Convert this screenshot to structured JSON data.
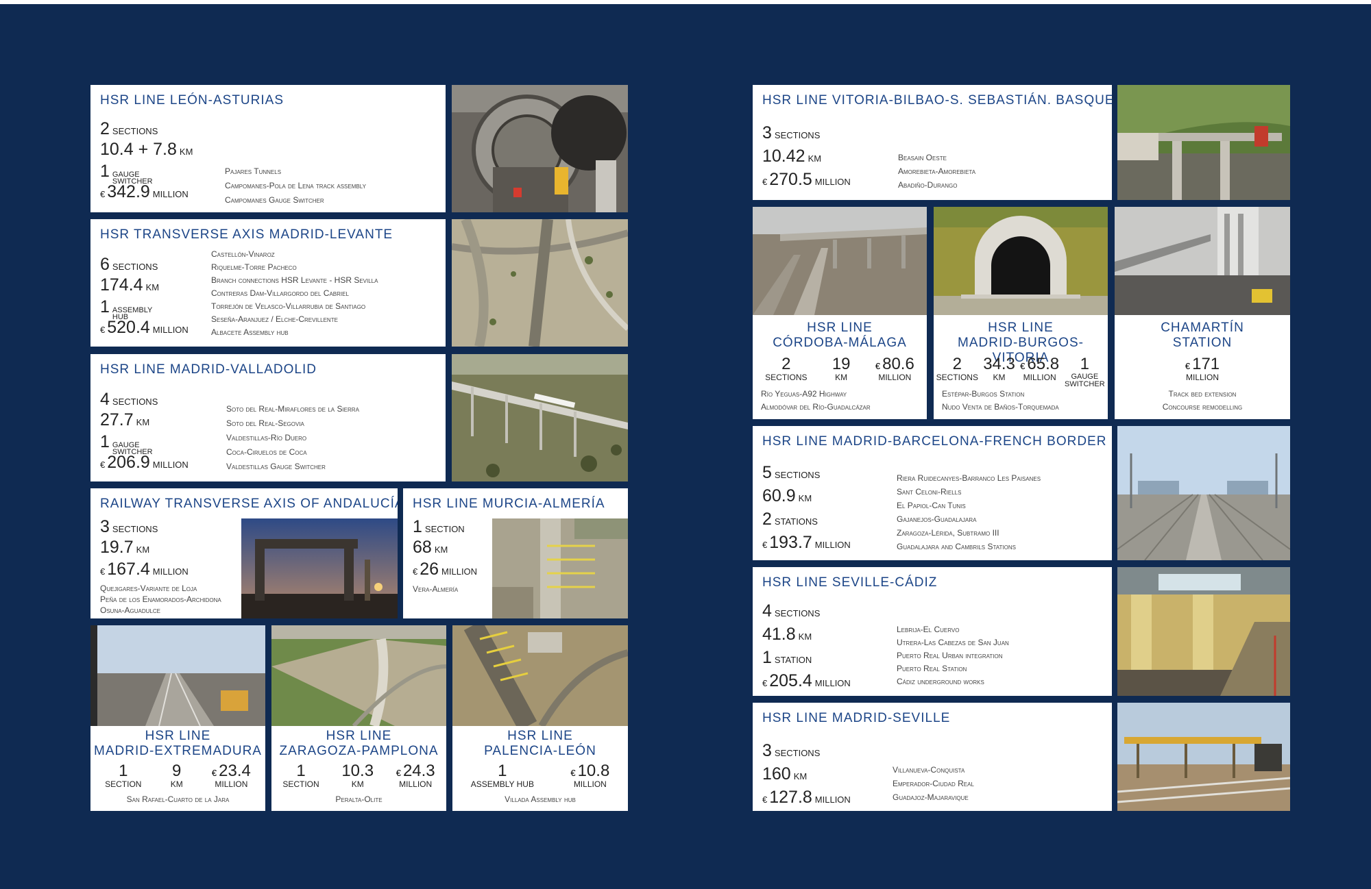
{
  "colors": {
    "page_bg": "#0f2a52",
    "title": "#1c4587",
    "card": "#ffffff"
  },
  "cards": {
    "leon": {
      "title": "HSR LINE LEÓN-ASTURIAS",
      "s1n": "2",
      "s1u": "SECTIONS",
      "s2n": "10.4 + 7.8",
      "s2u": "KM",
      "s3n": "1",
      "s3u": "GAUGE SWITCHER",
      "eur": "€",
      "s4n": "342.9",
      "s4u": "MILLION",
      "works": [
        "Pajares Tunnels",
        "Campomanes-Pola de Lena track assembly",
        "Campomanes Gauge Switcher"
      ]
    },
    "levante": {
      "title": "HSR TRANSVERSE AXIS MADRID-LEVANTE",
      "s1n": "6",
      "s1u": "SECTIONS",
      "s2n": "174.4",
      "s2u": "KM",
      "s3n": "1",
      "s3u": "ASSEMBLY HUB",
      "eur": "€",
      "s4n": "520.4",
      "s4u": "MILLION",
      "works": [
        "Castellón-Vinaroz",
        "Riquelme-Torre Pacheco",
        "Branch connections HSR Levante - HSR Sevilla",
        "Contreras Dam-Villargordo del Cabriel",
        "Torrejón de Velasco-Villarrubia de Santiago",
        "Seseña-Aranjuez / Elche-Crevillente",
        "Albacete Assembly hub"
      ]
    },
    "valladolid": {
      "title": "HSR LINE MADRID-VALLADOLID",
      "s1n": "4",
      "s1u": "SECTIONS",
      "s2n": "27.7",
      "s2u": "KM",
      "s3n": "1",
      "s3u": "GAUGE SWITCHER",
      "eur": "€",
      "s4n": "206.9",
      "s4u": "MILLION",
      "works": [
        "Soto del Real-Miraflores de la Sierra",
        "Soto del Real-Segovia",
        "Valdestillas-Río Duero",
        "Coca-Ciruelos de Coca",
        "Valdestillas Gauge Switcher"
      ]
    },
    "andalucia": {
      "title": "RAILWAY TRANSVERSE AXIS OF ANDALUCÍA",
      "s1n": "3",
      "s1u": "SECTIONS",
      "s2n": "19.7",
      "s2u": "KM",
      "eur": "€",
      "s3n": "167.4",
      "s3u": "MILLION",
      "works": [
        "Quejigares-Variante de Loja",
        "Peña de los Enamorados-Archidona",
        "Osuna-Aguadulce"
      ]
    },
    "murcia": {
      "title": "HSR LINE MURCIA-ALMERÍA",
      "s1n": "1",
      "s1u": "SECTION",
      "s2n": "68",
      "s2u": "KM",
      "eur": "€",
      "s3n": "26",
      "s3u": "MILLION",
      "works": [
        "Vera-Almería"
      ]
    },
    "extremadura": {
      "title1": "HSR LINE",
      "title2": "MADRID-EXTREMADURA",
      "a_n": "1",
      "a_l": "SECTION",
      "b_n": "9",
      "b_l": "KM",
      "eur": "€",
      "c_n": "23.4",
      "c_l": "MILLION",
      "works": [
        "San Rafael-Cuarto de la Jara"
      ]
    },
    "pamplona": {
      "title1": "HSR LINE",
      "title2": "ZARAGOZA-PAMPLONA",
      "a_n": "1",
      "a_l": "SECTION",
      "b_n": "10.3",
      "b_l": "KM",
      "eur": "€",
      "c_n": "24.3",
      "c_l": "MILLION",
      "works": [
        "Peralta-Olite"
      ]
    },
    "palencia": {
      "title1": "HSR LINE",
      "title2": "PALENCIA-LEÓN",
      "a_n": "1",
      "a_l": "ASSEMBLY HUB",
      "eur": "€",
      "c_n": "10.8",
      "c_l": "MILLION",
      "works": [
        "Villada Assembly hub"
      ]
    },
    "basque": {
      "title": "HSR LINE VITORIA-BILBAO-S. SEBASTIÁN. BASQUE “Y”",
      "s1n": "3",
      "s1u": "SECTIONS",
      "s2n": "10.42",
      "s2u": "KM",
      "eur": "€",
      "s3n": "270.5",
      "s3u": "MILLION",
      "works": [
        "Beasain Oeste",
        "Amorebieta-Amorebieta",
        "Abadiño-Durango"
      ]
    },
    "malaga": {
      "title1": "HSR LINE",
      "title2": "CÓRDOBA-MÁLAGA",
      "a_n": "2",
      "a_l": "SECTIONS",
      "b_n": "19",
      "b_l": "KM",
      "eur": "€",
      "c_n": "80.6",
      "c_l": "MILLION",
      "works": [
        "Río Yeguas-A92 Highway",
        "Almodóvar del Río-Guadalcázar"
      ]
    },
    "burgos": {
      "title1": "HSR LINE",
      "title2": "MADRID-BURGOS-VITORIA",
      "a_n": "2",
      "a_l": "SECTIONS",
      "b_n": "34.3",
      "b_l": "KM",
      "eur": "€",
      "c_n": "65.8",
      "c_l": "MILLION",
      "d_n": "1",
      "d_l": "GAUGE SWITCHER",
      "works": [
        "Estépar-Burgos Station",
        "Nudo Venta de Baños-Torquemada"
      ]
    },
    "chamartin": {
      "title1": "CHAMARTÍN",
      "title2": "STATION",
      "eur": "€",
      "c_n": "171",
      "c_l": "MILLION",
      "works": [
        "Track bed extension",
        "Concourse remodelling"
      ]
    },
    "barcelona": {
      "title": "HSR LINE MADRID-BARCELONA-FRENCH BORDER",
      "s1n": "5",
      "s1u": "SECTIONS",
      "s2n": "60.9",
      "s2u": "KM",
      "s3n": "2",
      "s3u": "STATIONS",
      "eur": "€",
      "s4n": "193.7",
      "s4u": "MILLION",
      "works": [
        "Riera Ruidecanyes-Barranco Les Paisanes",
        "Sant Celoni-Riells",
        "El Papiol-Can Tunis",
        "Gajanejos-Guadalajara",
        "Zaragoza-Lérida, Subtramo III",
        "Guadalajara and Cambrils Stations"
      ]
    },
    "cadiz": {
      "title": "HSR LINE SEVILLE-CÁDIZ",
      "s1n": "4",
      "s1u": "SECTIONS",
      "s2n": "41.8",
      "s2u": "KM",
      "s3n": "1",
      "s3u": "STATION",
      "eur": "€",
      "s4n": "205.4",
      "s4u": "MILLION",
      "works": [
        "Lebrija-El Cuervo",
        "Utrera-Las Cabezas de San Juan",
        "Puerto Real Urban integration",
        "Puerto Real Station",
        "Cádiz underground works"
      ]
    },
    "seville": {
      "title": "HSR LINE MADRID-SEVILLE",
      "s1n": "3",
      "s1u": "SECTIONS",
      "s2n": "160",
      "s2u": "KM",
      "eur": "€",
      "s3n": "127.8",
      "s3u": "MILLION",
      "works": [
        "Villanueva-Conquista",
        "Emperador-Ciudad Real",
        "Guadajoz-Majaravique"
      ]
    }
  }
}
